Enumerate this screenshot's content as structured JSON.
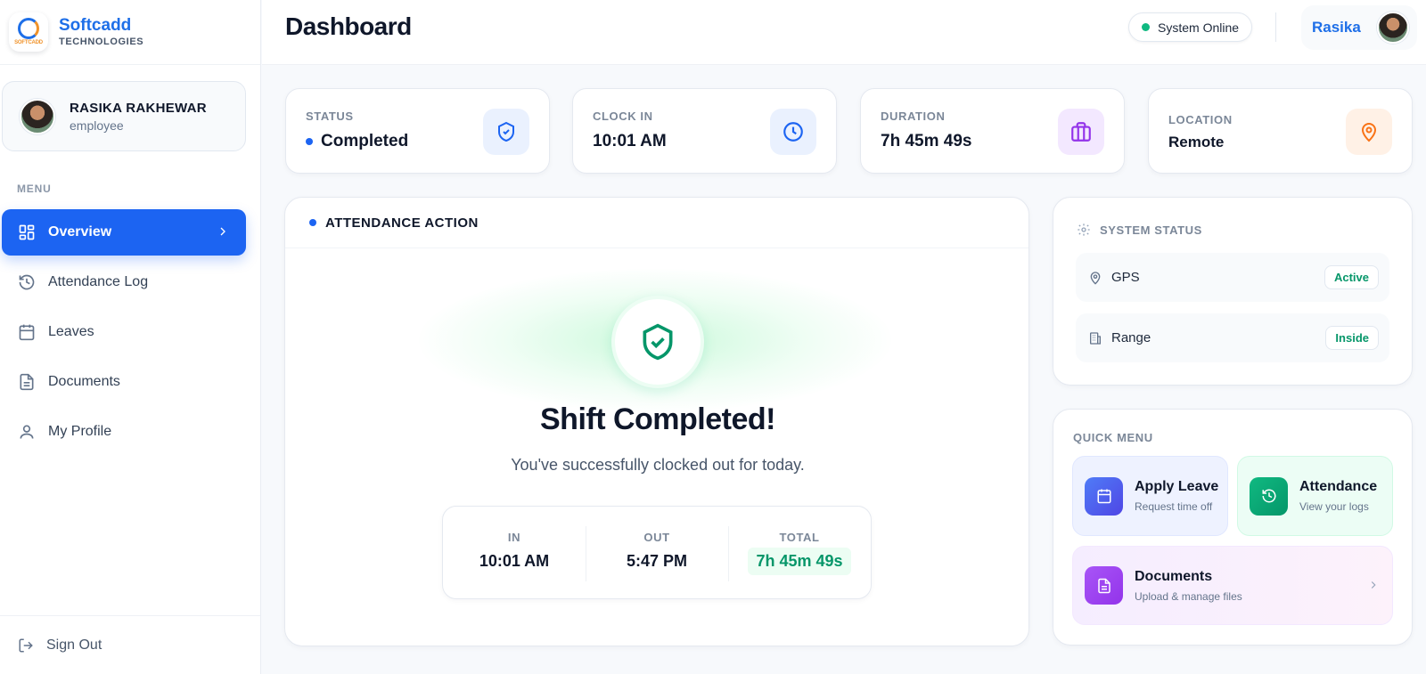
{
  "brand": {
    "name": "Softcadd",
    "sub": "TECHNOLOGIES",
    "logo_text": "SOFTCADD"
  },
  "header": {
    "title": "Dashboard",
    "system_status": "System Online",
    "user_name": "Rasika"
  },
  "sidebar": {
    "user": {
      "name": "RASIKA RAKHEWAR",
      "role": "employee"
    },
    "menu_label": "MENU",
    "items": [
      {
        "label": "Overview",
        "icon": "grid-icon"
      },
      {
        "label": "Attendance Log",
        "icon": "history-icon"
      },
      {
        "label": "Leaves",
        "icon": "calendar-icon"
      },
      {
        "label": "Documents",
        "icon": "document-icon"
      },
      {
        "label": "My Profile",
        "icon": "user-icon"
      }
    ],
    "sign_out": "Sign Out"
  },
  "stats": [
    {
      "label": "STATUS",
      "value": "Completed",
      "icon": "shield-check-icon",
      "color": "#1c64f2"
    },
    {
      "label": "CLOCK IN",
      "value": "10:01 AM",
      "icon": "clock-icon",
      "color": "#1c64f2"
    },
    {
      "label": "DURATION",
      "value": "7h 45m 49s",
      "icon": "briefcase-icon",
      "color": "#9333ea"
    },
    {
      "label": "LOCATION",
      "value": "Remote",
      "icon": "map-pin-icon",
      "color": "#f97316"
    }
  ],
  "attendance": {
    "title": "ATTENDANCE ACTION",
    "headline": "Shift Completed!",
    "message": "You've successfully clocked out for today.",
    "in_label": "IN",
    "in_value": "10:01 AM",
    "out_label": "OUT",
    "out_value": "5:47 PM",
    "total_label": "TOTAL",
    "total_value": "7h 45m 49s"
  },
  "system_status": {
    "title": "SYSTEM STATUS",
    "rows": [
      {
        "label": "GPS",
        "status": "Active"
      },
      {
        "label": "Range",
        "status": "Inside"
      }
    ]
  },
  "quick_menu": {
    "title": "QUICK MENU",
    "tiles": [
      {
        "title": "Apply Leave",
        "sub": "Request time off"
      },
      {
        "title": "Attendance",
        "sub": "View your logs"
      },
      {
        "title": "Documents",
        "sub": "Upload & manage files"
      }
    ]
  },
  "colors": {
    "primary": "#1c64f2",
    "success": "#059669",
    "online": "#10b981"
  }
}
